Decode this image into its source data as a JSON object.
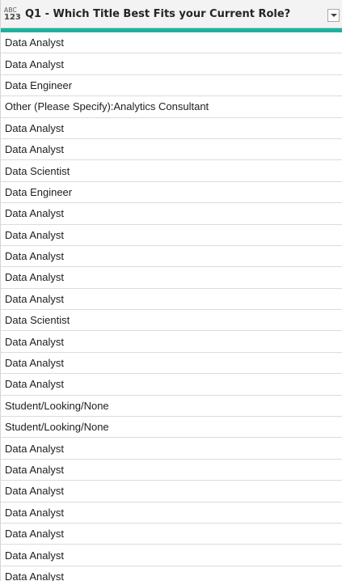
{
  "column": {
    "type_icon_top": "ABC",
    "type_icon_bottom": "123",
    "title": "Q1 - Which Title Best Fits your Current Role?",
    "quality_color": "#1bb29f"
  },
  "rows": [
    "Data Analyst",
    "Data Analyst",
    "Data Engineer",
    "Other (Please Specify):Analytics Consultant",
    "Data Analyst",
    "Data Analyst",
    "Data Scientist",
    "Data Engineer",
    "Data Analyst",
    "Data Analyst",
    "Data Analyst",
    "Data Analyst",
    "Data Analyst",
    "Data Scientist",
    "Data Analyst",
    "Data Analyst",
    "Data Analyst",
    "Student/Looking/None",
    "Student/Looking/None",
    "Data Analyst",
    "Data Analyst",
    "Data Analyst",
    "Data Analyst",
    "Data Analyst",
    "Data Analyst",
    "Data Analyst"
  ]
}
